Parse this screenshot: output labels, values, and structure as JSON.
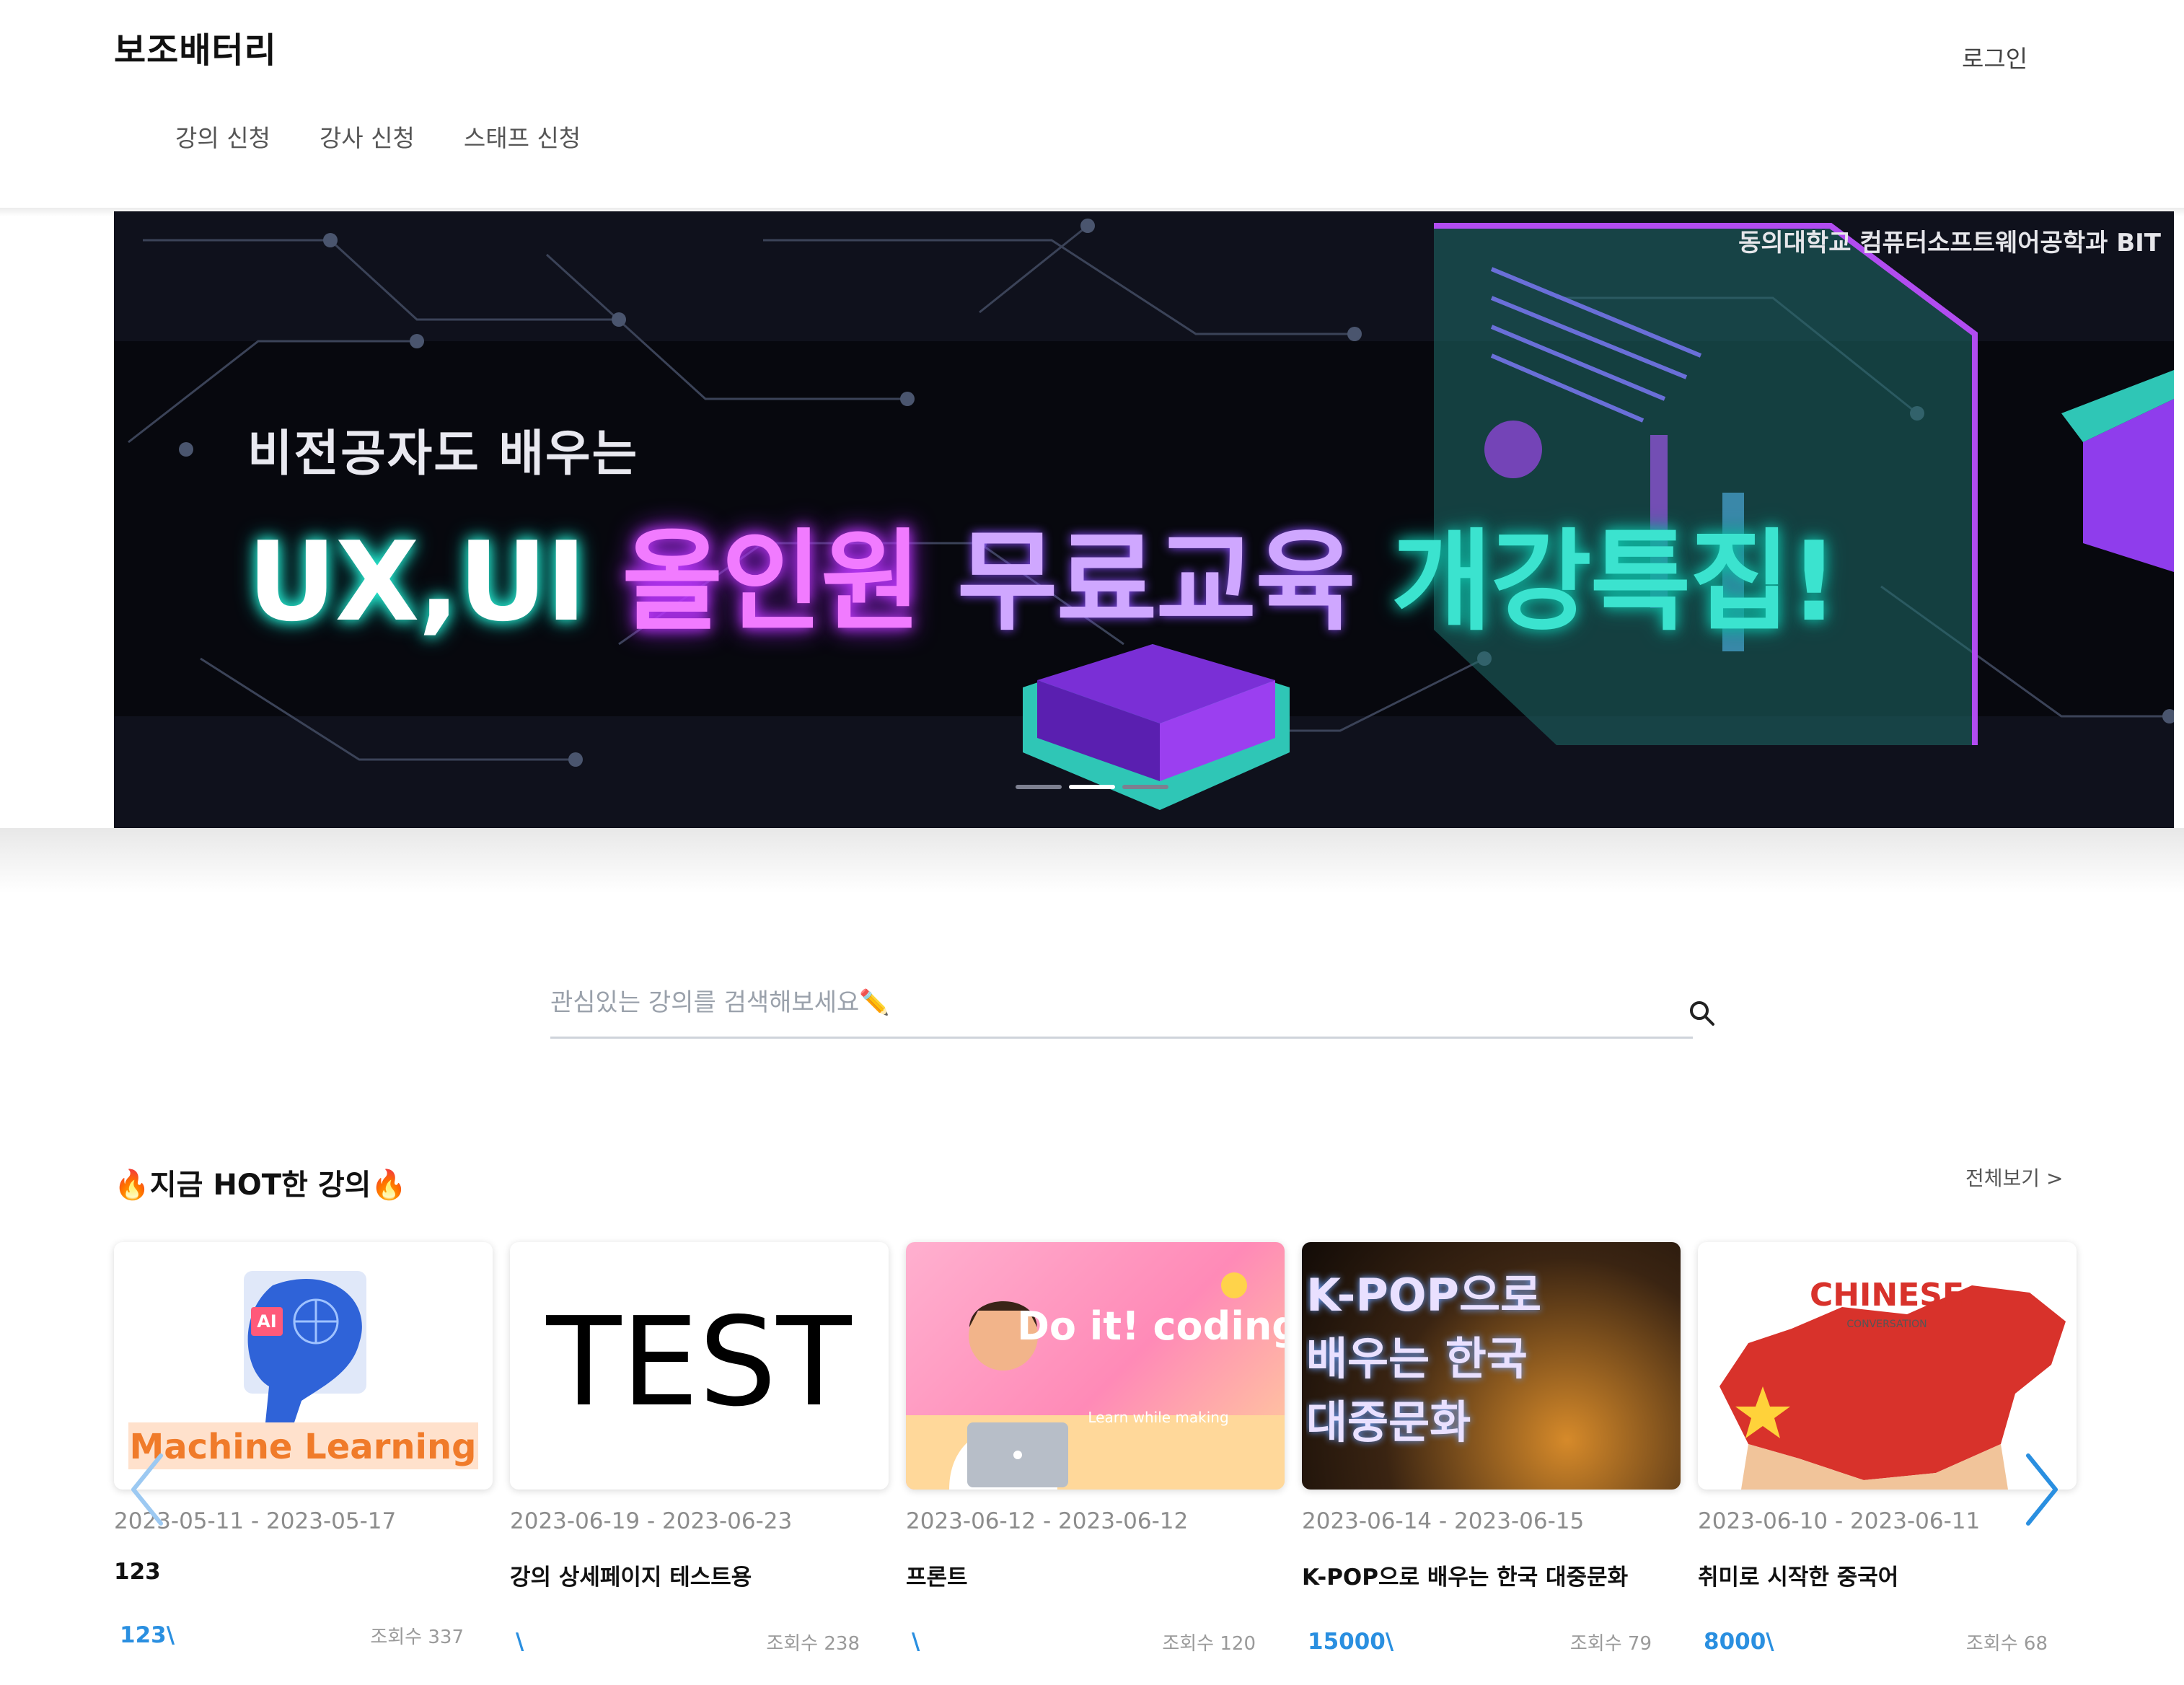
{
  "header": {
    "brand": "보조배터리",
    "login_label": "로그인",
    "nav": [
      "강의 신청",
      "강사 신청",
      "스태프 신청"
    ]
  },
  "banner": {
    "caption": "동의대학교 컴퓨터소프트웨어공학과 BIT",
    "subtitle": "비전공자도 배우는",
    "headline_a": "UX,UI ",
    "headline_b": "올인원 ",
    "headline_c": "무료교육 ",
    "headline_d": "개강특집!",
    "slide_count": 3,
    "active_slide": 2
  },
  "search": {
    "placeholder": "관심있는 강의를 검색해보세요✏️",
    "icon": "search-icon"
  },
  "hot_section": {
    "title": "🔥지금 HOT한 강의🔥",
    "see_all": "전체보기 >"
  },
  "courses": [
    {
      "thumb_text": "Machine Learning",
      "thumb_badge": "AI",
      "dates": "2023-05-11 - 2023-05-17",
      "title": "123",
      "price": "123\\",
      "views": "조회수 337"
    },
    {
      "thumb_text": "TEST",
      "dates": "2023-06-19 - 2023-06-23",
      "title": "강의 상세페이지 테스트용",
      "price": "\\",
      "views": "조회수 238"
    },
    {
      "thumb_text": "Do it! coding",
      "thumb_sub": "Learn while making",
      "dates": "2023-06-12 - 2023-06-12",
      "title": "프론트",
      "price": "\\",
      "views": "조회수 120"
    },
    {
      "thumb_text": "K-POP으로 배우는 한국 대중문화",
      "dates": "2023-06-14 - 2023-06-15",
      "title": "K-POP으로 배우는 한국 대중문화",
      "price": "15000\\",
      "views": "조회수 79"
    },
    {
      "thumb_text": "CHINESE",
      "thumb_sub": "CONVERSATION",
      "dates": "2023-06-10 - 2023-06-11",
      "title": "취미로 시작한 중국어",
      "price": "8000\\",
      "views": "조회수 68"
    }
  ],
  "colors": {
    "price": "#2a8fe0",
    "carousel_arrow": "#2a8fe0"
  }
}
